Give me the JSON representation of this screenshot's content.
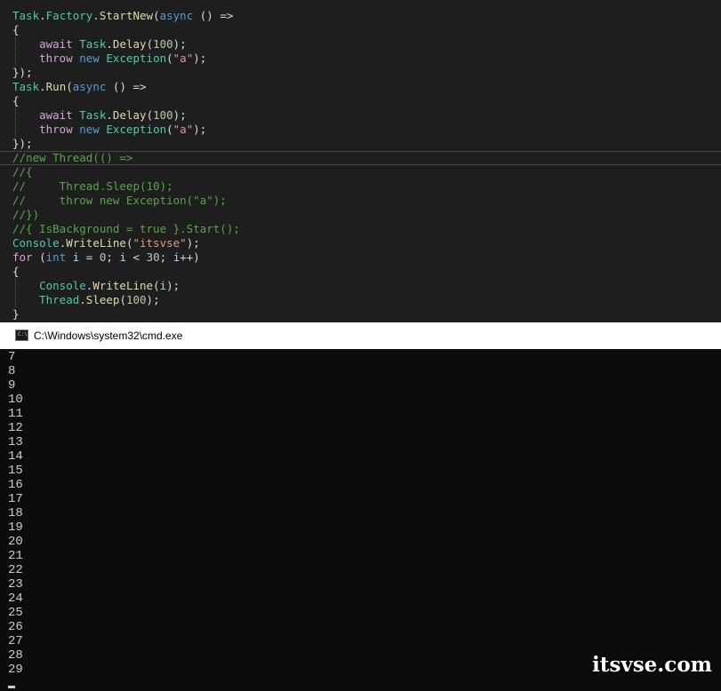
{
  "editor": {
    "lines": [
      [
        {
          "c": "t",
          "v": "Task"
        },
        {
          "c": "p",
          "v": "."
        },
        {
          "c": "t",
          "v": "Factory"
        },
        {
          "c": "p",
          "v": "."
        },
        {
          "c": "m",
          "v": "StartNew"
        },
        {
          "c": "p",
          "v": "("
        },
        {
          "c": "k",
          "v": "async"
        },
        {
          "c": "p",
          "v": " () =>"
        }
      ],
      [
        {
          "c": "p",
          "v": "{"
        }
      ],
      [
        {
          "c": "p",
          "v": "    "
        },
        {
          "c": "c",
          "v": "await"
        },
        {
          "c": "p",
          "v": " "
        },
        {
          "c": "t",
          "v": "Task"
        },
        {
          "c": "p",
          "v": "."
        },
        {
          "c": "m",
          "v": "Delay"
        },
        {
          "c": "p",
          "v": "("
        },
        {
          "c": "n",
          "v": "100"
        },
        {
          "c": "p",
          "v": ");"
        }
      ],
      [
        {
          "c": "p",
          "v": "    "
        },
        {
          "c": "c",
          "v": "throw"
        },
        {
          "c": "p",
          "v": " "
        },
        {
          "c": "k",
          "v": "new"
        },
        {
          "c": "p",
          "v": " "
        },
        {
          "c": "t",
          "v": "Exception"
        },
        {
          "c": "p",
          "v": "("
        },
        {
          "c": "s",
          "v": "\"a\""
        },
        {
          "c": "p",
          "v": ");"
        }
      ],
      [
        {
          "c": "p",
          "v": "});"
        }
      ],
      [
        {
          "c": "t",
          "v": "Task"
        },
        {
          "c": "p",
          "v": "."
        },
        {
          "c": "m",
          "v": "Run"
        },
        {
          "c": "p",
          "v": "("
        },
        {
          "c": "k",
          "v": "async"
        },
        {
          "c": "p",
          "v": " () =>"
        }
      ],
      [
        {
          "c": "p",
          "v": "{"
        }
      ],
      [
        {
          "c": "p",
          "v": "    "
        },
        {
          "c": "c",
          "v": "await"
        },
        {
          "c": "p",
          "v": " "
        },
        {
          "c": "t",
          "v": "Task"
        },
        {
          "c": "p",
          "v": "."
        },
        {
          "c": "m",
          "v": "Delay"
        },
        {
          "c": "p",
          "v": "("
        },
        {
          "c": "n",
          "v": "100"
        },
        {
          "c": "p",
          "v": ");"
        }
      ],
      [
        {
          "c": "p",
          "v": "    "
        },
        {
          "c": "c",
          "v": "throw"
        },
        {
          "c": "p",
          "v": " "
        },
        {
          "c": "k",
          "v": "new"
        },
        {
          "c": "p",
          "v": " "
        },
        {
          "c": "t",
          "v": "Exception"
        },
        {
          "c": "p",
          "v": "("
        },
        {
          "c": "s",
          "v": "\"a\""
        },
        {
          "c": "p",
          "v": ");"
        }
      ],
      [
        {
          "c": "p",
          "v": "});"
        }
      ],
      [
        {
          "c": "cm",
          "v": "//new Thread(() =>"
        }
      ],
      [
        {
          "c": "cm",
          "v": "//{"
        }
      ],
      [
        {
          "c": "cm",
          "v": "//     Thread.Sleep(10);"
        }
      ],
      [
        {
          "c": "cm",
          "v": "//     throw new Exception(\"a\");"
        }
      ],
      [
        {
          "c": "cm",
          "v": "//})"
        }
      ],
      [
        {
          "c": "cm",
          "v": "//{ IsBackground = true }.Start();"
        }
      ],
      [
        {
          "c": "t",
          "v": "Console"
        },
        {
          "c": "p",
          "v": "."
        },
        {
          "c": "m",
          "v": "WriteLine"
        },
        {
          "c": "p",
          "v": "("
        },
        {
          "c": "s",
          "v": "\"itsvse\""
        },
        {
          "c": "p",
          "v": ");"
        }
      ],
      [
        {
          "c": "c",
          "v": "for"
        },
        {
          "c": "p",
          "v": " ("
        },
        {
          "c": "k",
          "v": "int"
        },
        {
          "c": "p",
          "v": " "
        },
        {
          "c": "v",
          "v": "i"
        },
        {
          "c": "p",
          "v": " = "
        },
        {
          "c": "n",
          "v": "0"
        },
        {
          "c": "p",
          "v": "; "
        },
        {
          "c": "v",
          "v": "i"
        },
        {
          "c": "p",
          "v": " < "
        },
        {
          "c": "n",
          "v": "30"
        },
        {
          "c": "p",
          "v": "; "
        },
        {
          "c": "v",
          "v": "i"
        },
        {
          "c": "p",
          "v": "++)"
        }
      ],
      [
        {
          "c": "p",
          "v": "{"
        }
      ],
      [
        {
          "c": "p",
          "v": "    "
        },
        {
          "c": "t",
          "v": "Console"
        },
        {
          "c": "p",
          "v": "."
        },
        {
          "c": "m",
          "v": "WriteLine"
        },
        {
          "c": "p",
          "v": "("
        },
        {
          "c": "v",
          "v": "i"
        },
        {
          "c": "p",
          "v": ");"
        }
      ],
      [
        {
          "c": "p",
          "v": "    "
        },
        {
          "c": "t",
          "v": "Thread"
        },
        {
          "c": "p",
          "v": "."
        },
        {
          "c": "m",
          "v": "Sleep"
        },
        {
          "c": "p",
          "v": "("
        },
        {
          "c": "n",
          "v": "100"
        },
        {
          "c": "p",
          "v": ");"
        }
      ],
      [
        {
          "c": "p",
          "v": "}"
        }
      ]
    ]
  },
  "console_window": {
    "title": "C:\\Windows\\system32\\cmd.exe",
    "icon": "cmd-icon",
    "icon_text": "C:\\",
    "output": [
      "7",
      "8",
      "9",
      "10",
      "11",
      "12",
      "13",
      "14",
      "15",
      "16",
      "17",
      "18",
      "19",
      "20",
      "21",
      "22",
      "23",
      "24",
      "25",
      "26",
      "27",
      "28",
      "29"
    ]
  },
  "watermark": "itsvse.com",
  "colors": {
    "editor_bg": "#1e1e1e",
    "console_bg": "#0c0c0c",
    "type": "#4ec9b0",
    "keyword": "#569cd6",
    "control_keyword": "#d8a0df",
    "method": "#dcdcaa",
    "string": "#d69d85",
    "number": "#b5cea8",
    "comment": "#57a64a"
  }
}
